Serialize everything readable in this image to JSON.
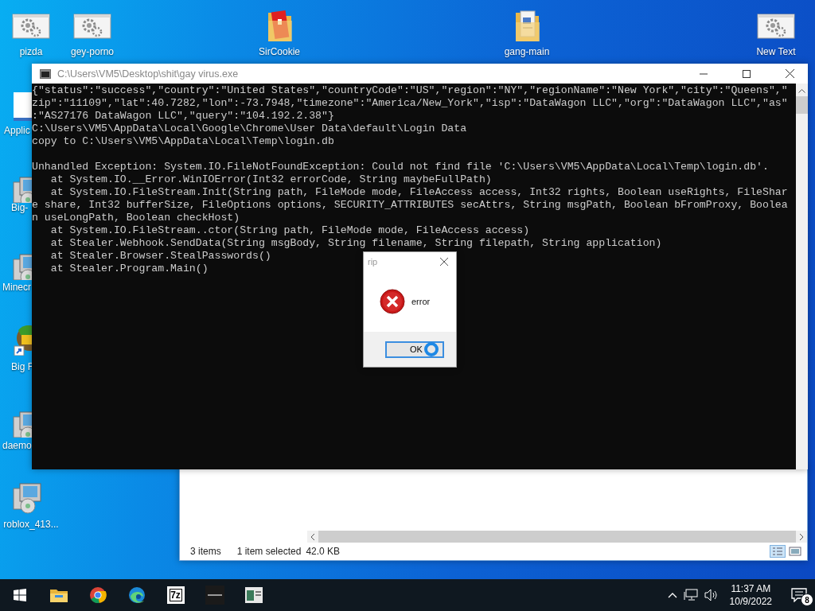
{
  "desktop_icons": [
    {
      "label": "pizda",
      "kind": "gears"
    },
    {
      "label": "gey-porno",
      "kind": "gears"
    },
    {
      "label": "SirCookie",
      "kind": "redfolder"
    },
    {
      "label": "gang-main",
      "kind": "docfolder"
    },
    {
      "label": "New Text",
      "kind": "gears"
    },
    {
      "label": "Applic",
      "kind": "blank"
    },
    {
      "label": "Big-",
      "kind": "installer"
    },
    {
      "label": "Minecr",
      "kind": "installer"
    },
    {
      "label": "Big F",
      "kind": "game"
    },
    {
      "label": "daemo",
      "kind": "installer"
    },
    {
      "label": "roblox_413...",
      "kind": "installer"
    }
  ],
  "explorer": {
    "item_count": "3 items",
    "selection": "1 item selected",
    "size": "42.0 KB"
  },
  "console": {
    "title": "C:\\Users\\VM5\\Desktop\\shit\\gay virus.exe",
    "blocks": [
      [
        "{\"status\":\"success\",\"country\":\"United States\",\"countryCode\":\"US\",\"region\":\"NY\",\"regionName\":\"New York\",\"city\":\"Queens\",\"",
        "zip\":\"11109\",\"lat\":40.7282,\"lon\":-73.7948,\"timezone\":\"America/New_York\",\"isp\":\"DataWagon LLC\",\"org\":\"DataWagon LLC\",\"as\"",
        ":\"AS27176 DataWagon LLC\",\"query\":\"104.192.2.38\"}",
        "C:\\Users\\VM5\\AppData\\Local\\Google\\Chrome\\User Data\\default\\Login Data",
        "copy to C:\\Users\\VM5\\AppData\\Local\\Temp\\login.db"
      ],
      [
        "Unhandled Exception: System.IO.FileNotFoundException: Could not find file 'C:\\Users\\VM5\\AppData\\Local\\Temp\\login.db'.",
        "   at System.IO.__Error.WinIOError(Int32 errorCode, String maybeFullPath)",
        "   at System.IO.FileStream.Init(String path, FileMode mode, FileAccess access, Int32 rights, Boolean useRights, FileShar",
        "e share, Int32 bufferSize, FileOptions options, SECURITY_ATTRIBUTES secAttrs, String msgPath, Boolean bFromProxy, Boolea",
        "n useLongPath, Boolean checkHost)",
        "   at System.IO.FileStream..ctor(String path, FileMode mode, FileAccess access)",
        "   at Stealer.Webhook.SendData(String msgBody, String filename, String filepath, String application)",
        "   at Stealer.Browser.StealPasswords()",
        "   at Stealer.Program.Main()"
      ]
    ]
  },
  "dialog": {
    "title": "rip",
    "message": "error",
    "button": "OK"
  },
  "taskbar": {
    "apps": [
      {
        "kind": "start"
      },
      {
        "kind": "explorer"
      },
      {
        "kind": "chrome"
      },
      {
        "kind": "edge"
      },
      {
        "kind": "archiver",
        "label": "7z"
      },
      {
        "kind": "dark"
      },
      {
        "kind": "window"
      }
    ],
    "time": "11:37 AM",
    "date": "10/9/2022",
    "notifications": "8"
  }
}
